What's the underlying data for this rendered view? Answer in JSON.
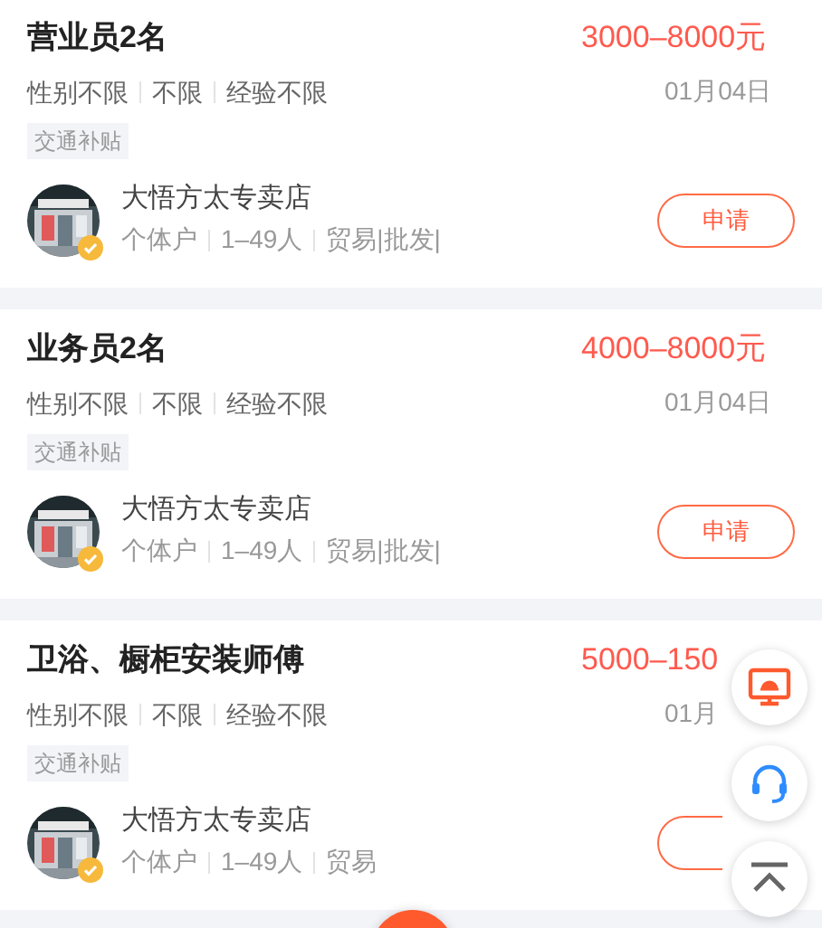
{
  "jobs": [
    {
      "title": "营业员2名",
      "salary": "3000–8000元",
      "requirements": [
        "性别不限",
        "不限",
        "经验不限"
      ],
      "date": "01月04日",
      "tags": [
        "交通补贴"
      ],
      "company": {
        "name": "大悟方太专卖店",
        "verified": true,
        "details": [
          "个体户",
          "1–49人",
          "贸易|批发|"
        ]
      },
      "apply": {
        "label": "申请"
      }
    },
    {
      "title": "业务员2名",
      "salary": "4000–8000元",
      "requirements": [
        "性别不限",
        "不限",
        "经验不限"
      ],
      "date": "01月04日",
      "tags": [
        "交通补贴"
      ],
      "company": {
        "name": "大悟方太专卖店",
        "verified": true,
        "details": [
          "个体户",
          "1–49人",
          "贸易|批发|"
        ]
      },
      "apply": {
        "label": "申请"
      }
    },
    {
      "title": "卫浴、橱柜安装师傅",
      "salary": "5000–150",
      "requirements": [
        "性别不限",
        "不限",
        "经验不限"
      ],
      "date": "01月",
      "tags": [
        "交通补贴"
      ],
      "company": {
        "name": "大悟方太专卖店",
        "verified": true,
        "details": [
          "个体户",
          "1–49人",
          "贸易"
        ]
      }
    }
  ],
  "floating_buttons": [
    {
      "kind": "monitor"
    },
    {
      "kind": "headset"
    },
    {
      "kind": "top"
    }
  ]
}
